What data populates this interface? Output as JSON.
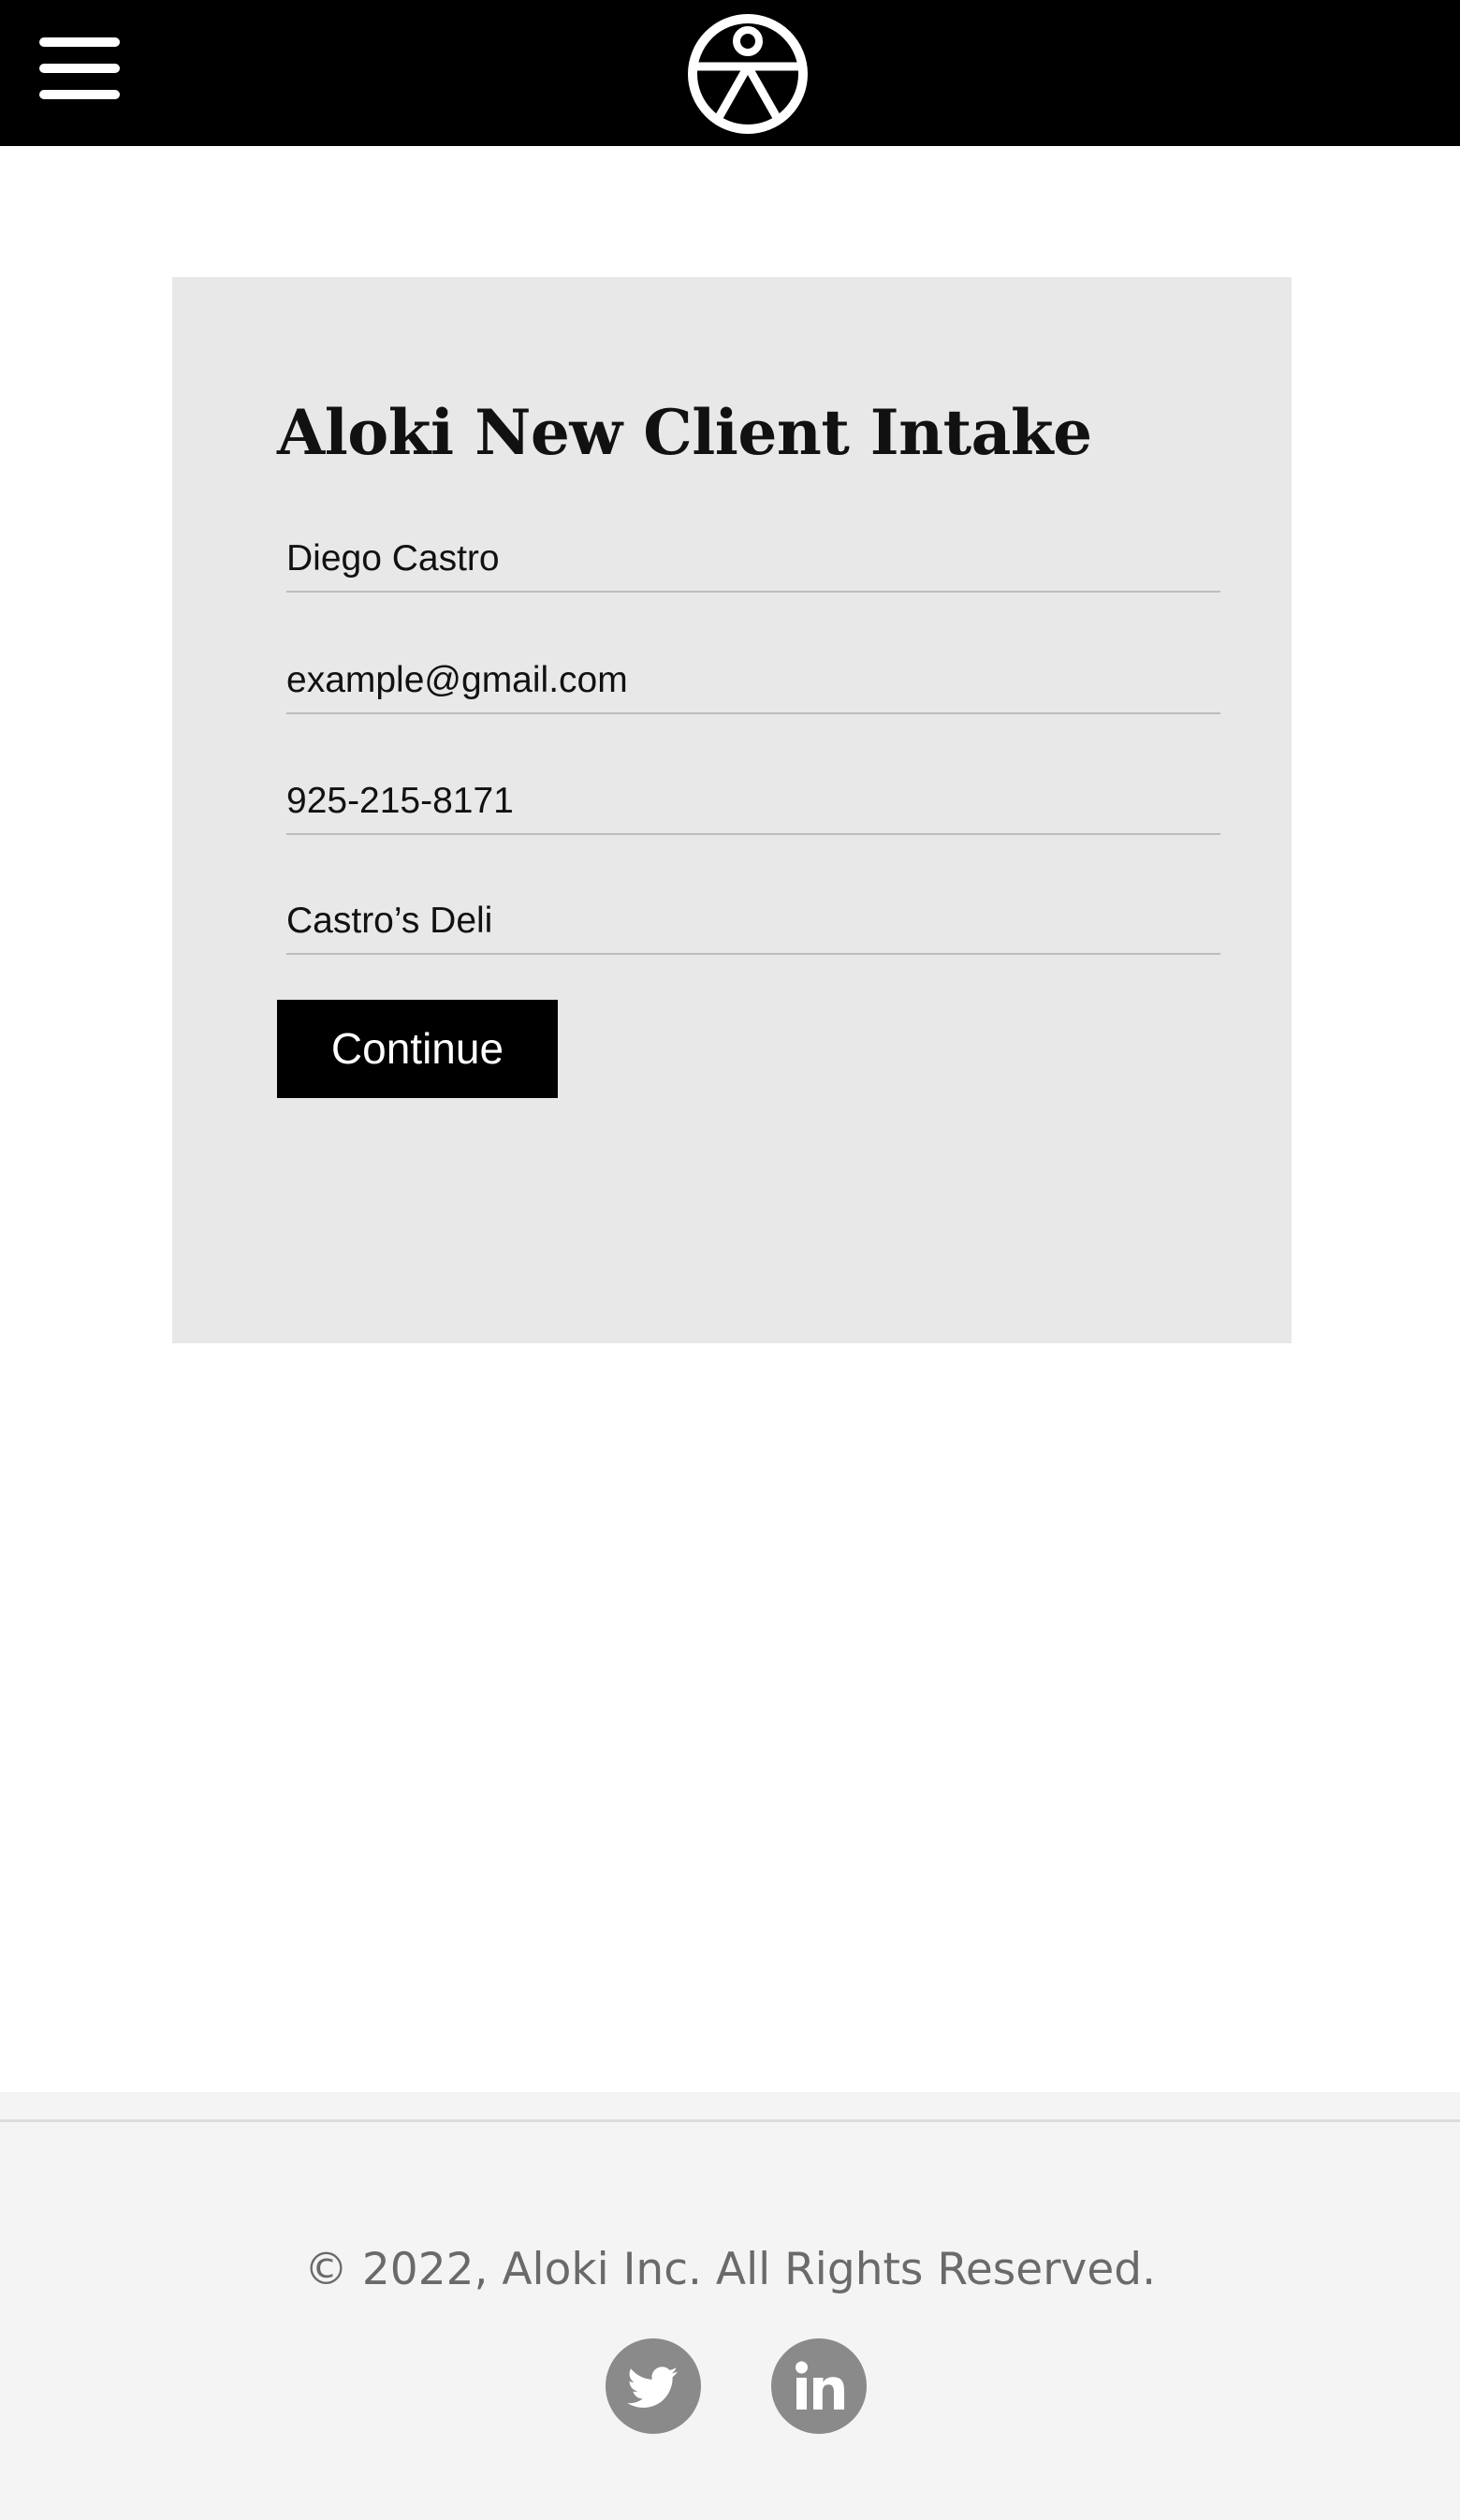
{
  "header": {
    "menu_icon": "hamburger-menu-icon",
    "logo_icon": "aloki-logo-icon"
  },
  "form": {
    "title": "Aloki New Client Intake",
    "fields": [
      {
        "name": "name",
        "value": "Diego Castro"
      },
      {
        "name": "email",
        "value": "example@gmail.com"
      },
      {
        "name": "phone",
        "value": "925-215-8171"
      },
      {
        "name": "business",
        "value": "Castro’s Deli"
      }
    ],
    "continue_label": "Continue"
  },
  "footer": {
    "copyright": "© 2022, Aloki Inc. All Rights Reserved.",
    "social": [
      {
        "icon": "twitter-icon"
      },
      {
        "icon": "linkedin-icon"
      }
    ]
  },
  "colors": {
    "header_bg": "#000000",
    "card_bg": "#e8e8e8",
    "button_bg": "#000000",
    "footer_bg": "#f4f4f4",
    "social_icon": "#8a8a8a"
  }
}
